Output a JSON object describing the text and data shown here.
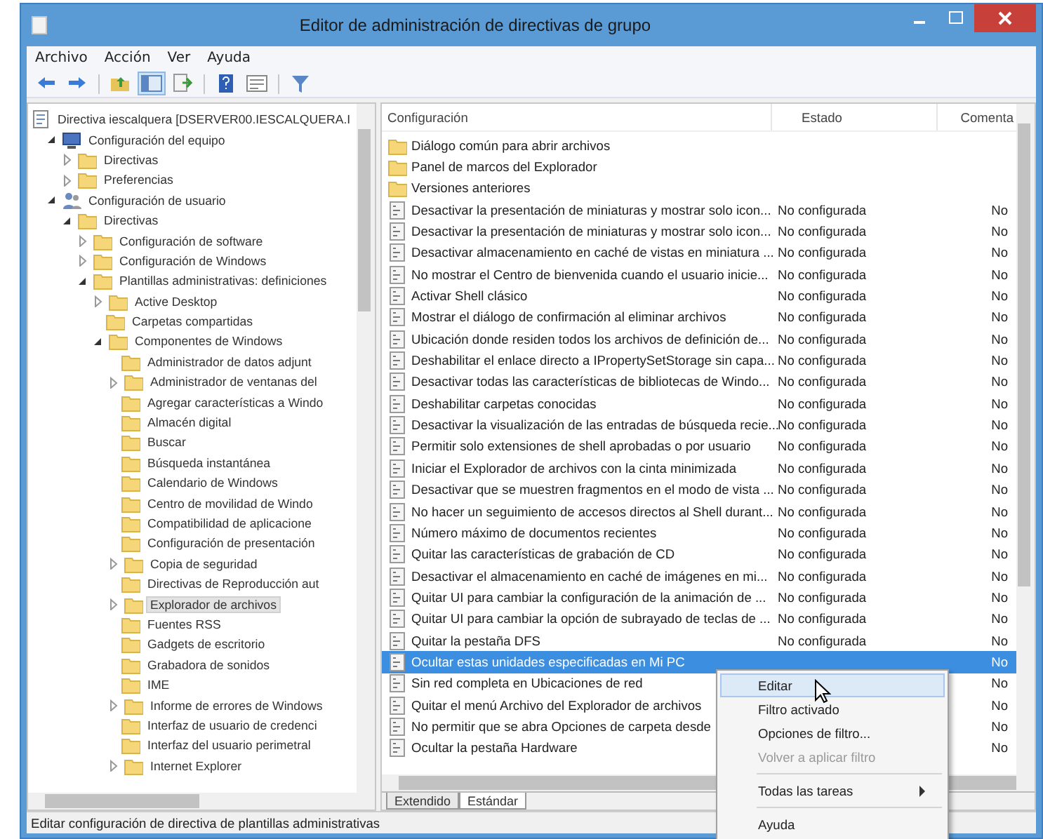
{
  "window": {
    "title": "Editor de administración de directivas de grupo"
  },
  "menu": [
    "Archivo",
    "Acción",
    "Ver",
    "Ayuda"
  ],
  "toolbar": [
    {
      "kind": "back"
    },
    {
      "kind": "forward"
    },
    {
      "kind": "up"
    },
    {
      "kind": "tree",
      "selected": true
    },
    {
      "kind": "export"
    },
    {
      "kind": "help"
    },
    {
      "kind": "panel"
    },
    {
      "kind": "filter"
    }
  ],
  "tree": [
    {
      "label": "Directiva iescalquera [DSERVER00.IESCALQUERA.I",
      "kind": "policy",
      "selected": false,
      "children": [
        {
          "label": "Configuración del equipo",
          "kind": "computer",
          "expanded": true,
          "selected": false,
          "children": [
            {
              "label": "Directivas",
              "expanded": false,
              "selected": false
            },
            {
              "label": "Preferencias",
              "expanded": false,
              "selected": false
            }
          ]
        },
        {
          "label": "Configuración de usuario",
          "kind": "users",
          "expanded": true,
          "selected": false,
          "children": [
            {
              "label": "Directivas",
              "expanded": true,
              "selected": false,
              "children": [
                {
                  "label": "Configuración de software",
                  "expanded": false,
                  "selected": false
                },
                {
                  "label": "Configuración de Windows",
                  "expanded": false,
                  "selected": false
                },
                {
                  "label": "Plantillas administrativas: definiciones",
                  "expanded": true,
                  "selected": false,
                  "children": [
                    {
                      "label": "Active Desktop",
                      "expanded": false,
                      "selected": false
                    },
                    {
                      "label": "Carpetas compartidas",
                      "selected": false
                    },
                    {
                      "label": "Componentes de Windows",
                      "expanded": true,
                      "selected": false,
                      "children": [
                        {
                          "label": "Administrador de datos adjunt",
                          "selected": false
                        },
                        {
                          "label": "Administrador de ventanas del",
                          "expanded": false,
                          "selected": false
                        },
                        {
                          "label": "Agregar características a Windo",
                          "selected": false
                        },
                        {
                          "label": "Almacén digital",
                          "selected": false
                        },
                        {
                          "label": "Buscar",
                          "selected": false
                        },
                        {
                          "label": "Búsqueda instantánea",
                          "selected": false
                        },
                        {
                          "label": "Calendario de Windows",
                          "selected": false
                        },
                        {
                          "label": "Centro de movilidad de Windo",
                          "selected": false
                        },
                        {
                          "label": "Compatibilidad de aplicacione",
                          "selected": false
                        },
                        {
                          "label": "Configuración de presentación",
                          "selected": false
                        },
                        {
                          "label": "Copia de seguridad",
                          "expanded": false,
                          "selected": false
                        },
                        {
                          "label": "Directivas de Reproducción aut",
                          "selected": false
                        },
                        {
                          "label": "Explorador de archivos",
                          "expanded": false,
                          "selected": true
                        },
                        {
                          "label": "Fuentes RSS",
                          "selected": false
                        },
                        {
                          "label": "Gadgets de escritorio",
                          "selected": false
                        },
                        {
                          "label": "Grabadora de sonidos",
                          "selected": false
                        },
                        {
                          "label": "IME",
                          "selected": false
                        },
                        {
                          "label": "Informe de errores de Windows",
                          "expanded": false,
                          "selected": false
                        },
                        {
                          "label": "Interfaz de usuario de credenci",
                          "selected": false
                        },
                        {
                          "label": "Interfaz del usuario perimetral",
                          "selected": false
                        },
                        {
                          "label": "Internet Explorer",
                          "expanded": false,
                          "selected": false
                        }
                      ]
                    }
                  ]
                }
              ]
            }
          ]
        }
      ]
    }
  ],
  "table": {
    "columns": [
      "Configuración",
      "Estado",
      "Comenta"
    ],
    "rows": [
      {
        "kind": "folder",
        "name": "Diálogo común para abrir archivos",
        "selected": false
      },
      {
        "kind": "folder",
        "name": "Panel de marcos del Explorador",
        "selected": false
      },
      {
        "kind": "folder",
        "name": "Versiones anteriores",
        "selected": false
      },
      {
        "kind": "setting",
        "name": "Desactivar la presentación de miniaturas y mostrar solo icon...",
        "state": "No configurada",
        "comment": "No",
        "selected": false
      },
      {
        "kind": "setting",
        "name": "Desactivar la presentación de miniaturas y mostrar solo icon...",
        "state": "No configurada",
        "comment": "No",
        "selected": false
      },
      {
        "kind": "setting",
        "name": "Desactivar almacenamiento en caché de vistas en miniatura ...",
        "state": "No configurada",
        "comment": "No",
        "selected": false
      },
      {
        "kind": "setting",
        "name": "No mostrar el Centro de bienvenida cuando el usuario inicie...",
        "state": "No configurada",
        "comment": "No",
        "selected": false
      },
      {
        "kind": "setting",
        "name": "Activar Shell clásico",
        "state": "No configurada",
        "comment": "No",
        "selected": false
      },
      {
        "kind": "setting",
        "name": "Mostrar el diálogo de confirmación al eliminar archivos",
        "state": "No configurada",
        "comment": "No",
        "selected": false
      },
      {
        "kind": "setting",
        "name": "Ubicación donde residen todos los archivos de definición de...",
        "state": "No configurada",
        "comment": "No",
        "selected": false
      },
      {
        "kind": "setting",
        "name": "Deshabilitar el enlace directo a IPropertySetStorage sin capa...",
        "state": "No configurada",
        "comment": "No",
        "selected": false
      },
      {
        "kind": "setting",
        "name": "Desactivar todas las características de bibliotecas de Windo...",
        "state": "No configurada",
        "comment": "No",
        "selected": false
      },
      {
        "kind": "setting",
        "name": "Deshabilitar carpetas conocidas",
        "state": "No configurada",
        "comment": "No",
        "selected": false
      },
      {
        "kind": "setting",
        "name": "Desactivar la visualización de las entradas de búsqueda recie...",
        "state": "No configurada",
        "comment": "No",
        "selected": false
      },
      {
        "kind": "setting",
        "name": "Permitir solo extensiones de shell aprobadas o por usuario",
        "state": "No configurada",
        "comment": "No",
        "selected": false
      },
      {
        "kind": "setting",
        "name": "Iniciar el Explorador de archivos con la cinta minimizada",
        "state": "No configurada",
        "comment": "No",
        "selected": false
      },
      {
        "kind": "setting",
        "name": "Desactivar que se muestren fragmentos en el modo de vista ...",
        "state": "No configurada",
        "comment": "No",
        "selected": false
      },
      {
        "kind": "setting",
        "name": "No hacer un seguimiento de accesos directos al Shell durant...",
        "state": "No configurada",
        "comment": "No",
        "selected": false
      },
      {
        "kind": "setting",
        "name": "Número máximo de documentos recientes",
        "state": "No configurada",
        "comment": "No",
        "selected": false
      },
      {
        "kind": "setting",
        "name": "Quitar las características de grabación de CD",
        "state": "No configurada",
        "comment": "No",
        "selected": false
      },
      {
        "kind": "setting",
        "name": "Desactivar el almacenamiento en caché de imágenes en mi...",
        "state": "No configurada",
        "comment": "No",
        "selected": false
      },
      {
        "kind": "setting",
        "name": "Quitar UI para cambiar la configuración de la animación de ...",
        "state": "No configurada",
        "comment": "No",
        "selected": false
      },
      {
        "kind": "setting",
        "name": "Quitar UI para cambiar la opción de subrayado de teclas de ...",
        "state": "No configurada",
        "comment": "No",
        "selected": false
      },
      {
        "kind": "setting",
        "name": "Quitar la pestaña DFS",
        "state": "No configurada",
        "comment": "No",
        "selected": false
      },
      {
        "kind": "setting",
        "name": "Ocultar estas unidades especificadas en Mi PC",
        "comment": "No",
        "selected": true
      },
      {
        "kind": "setting",
        "name": "Sin red completa en Ubicaciones de red",
        "comment": "No",
        "selected": false
      },
      {
        "kind": "setting",
        "name": "Quitar el menú Archivo del Explorador de archivos",
        "comment": "No",
        "selected": false
      },
      {
        "kind": "setting",
        "name": "No permitir que se abra Opciones de carpeta desde",
        "comment": "No",
        "selected": false
      },
      {
        "kind": "setting",
        "name": "Ocultar la pestaña Hardware",
        "comment": "No",
        "selected": false
      }
    ]
  },
  "view_tabs": [
    {
      "label": "Extendido",
      "selected": false
    },
    {
      "label": "Estándar",
      "selected": true
    }
  ],
  "context_menu": [
    {
      "kind": "item",
      "label": "Editar",
      "selected": true,
      "disabled": false
    },
    {
      "kind": "item",
      "label": "Filtro activado",
      "selected": false,
      "disabled": false
    },
    {
      "kind": "item",
      "label": "Opciones de filtro...",
      "selected": false,
      "disabled": false
    },
    {
      "kind": "item",
      "label": "Volver a aplicar filtro",
      "selected": false,
      "disabled": true
    },
    {
      "kind": "separator"
    },
    {
      "kind": "submenu",
      "label": "Todas las tareas",
      "selected": false,
      "disabled": false
    },
    {
      "kind": "separator"
    },
    {
      "kind": "item",
      "label": "Ayuda",
      "selected": false,
      "disabled": false
    }
  ],
  "status_bar": "Editar configuración de directiva de plantillas administrativas"
}
